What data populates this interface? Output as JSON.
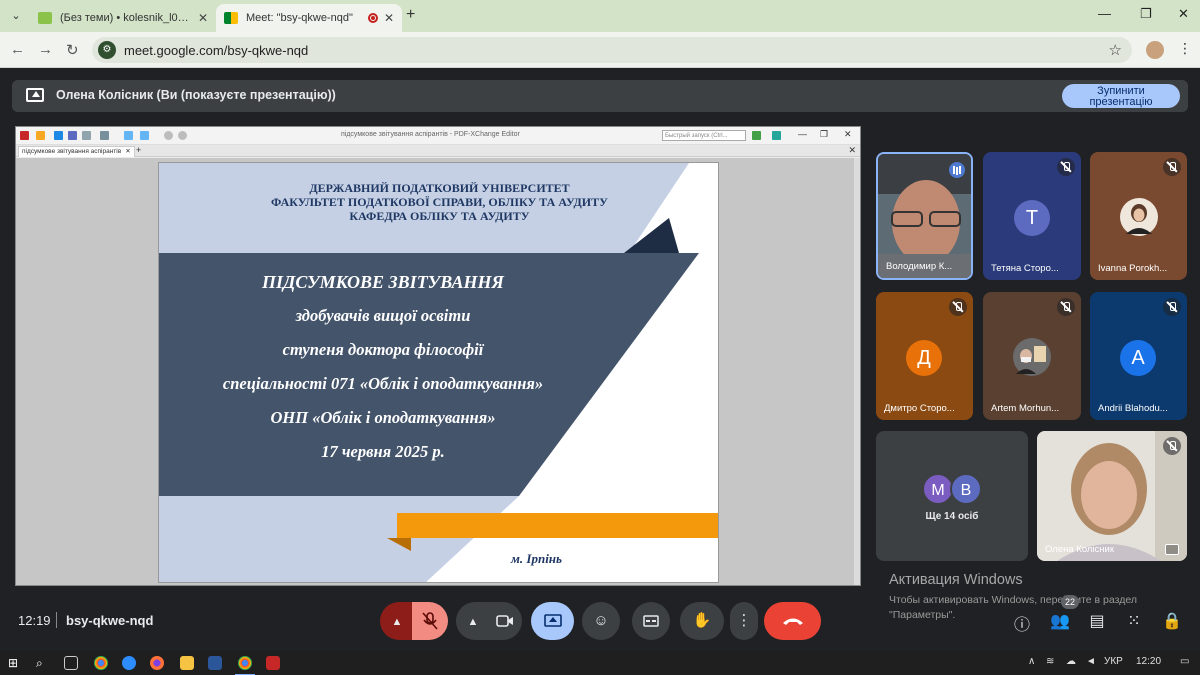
{
  "browser": {
    "tabs": [
      {
        "title": "(Без теми) • kolesnik_l09@ukr.n",
        "favicon_color": "#6aa84f"
      },
      {
        "title": "Meet: \"bsy-qkwe-nqd\"",
        "favicon_color": "#00832d"
      }
    ],
    "url": "meet.google.com/bsy-qkwe-nqd"
  },
  "meet": {
    "presenting_text": "Олена Колісник (Ви (показуєте презентацію))",
    "stop_button": {
      "line1": "Зупинити",
      "line2": "презентацію"
    },
    "time": "12:19",
    "meeting_code": "bsy-qkwe-nqd",
    "people_count": "22",
    "more_people": "Ще 14 осіб",
    "more_avatars": [
      {
        "letter": "M",
        "color": "#7b5cc0"
      },
      {
        "letter": "B",
        "color": "#5c6bc0"
      }
    ]
  },
  "pdf_editor": {
    "window_title": "підсумкове звітування аспірантів - PDF-XChange Editor",
    "search_placeholder": "Быстрый запуск (Ctrl...",
    "tab_label": "підсумкове звітування аспірантів"
  },
  "slide": {
    "header_lines": [
      "ДЕРЖАВНИЙ ПОДАТКОВИЙ УНІВЕРСИТЕТ",
      "ФАКУЛЬТЕТ ПОДАТКОВОЇ СПРАВИ, ОБЛІКУ ТА АУДИТУ",
      "КАФЕДРА ОБЛІКУ ТА АУДИТУ"
    ],
    "title_lines": [
      "ПІДСУМКОВЕ ЗВІТУВАННЯ",
      "здобувачів вищої освіти",
      "ступеня доктора філософії",
      "спеціальності 071 «Облік і оподаткування»",
      "ОНП «Облік і оподаткування»",
      "17 червня 2025 р."
    ],
    "city": "м. Ірпінь",
    "colors": {
      "navy": "#44546a",
      "light": "#c5d0e4",
      "orange": "#f4980c",
      "dark": "#1f2d44"
    }
  },
  "participants": [
    {
      "name": "Володимир К...",
      "type": "video",
      "status": "speaking"
    },
    {
      "name": "Тетяна Сторо...",
      "type": "letter",
      "letter": "Т",
      "color": "#5c6bc0",
      "bg": "#2b3a7a",
      "status": "muted"
    },
    {
      "name": "Ivanna Porokh...",
      "type": "photo",
      "bg": "#7a4a30",
      "status": "muted"
    },
    {
      "name": "Дмитро Сторо...",
      "type": "letter",
      "letter": "Д",
      "color": "#e8710a",
      "bg": "#8a4a12",
      "status": "muted"
    },
    {
      "name": "Artem Morhun...",
      "type": "photo",
      "bg": "#5a4030",
      "status": "muted"
    },
    {
      "name": "Andrii Blahodu...",
      "type": "letter",
      "letter": "A",
      "color": "#1a73e8",
      "bg": "#0d3a6e",
      "status": "muted"
    },
    {
      "name": "Олена Колісник",
      "type": "video",
      "status": "muted"
    }
  ],
  "windows": {
    "activation_title": "Активация Windows",
    "activation_text": "Чтобы активировать Windows, перейдите в раздел \"Параметры\".",
    "language": "УКР",
    "clock": "12:20"
  }
}
